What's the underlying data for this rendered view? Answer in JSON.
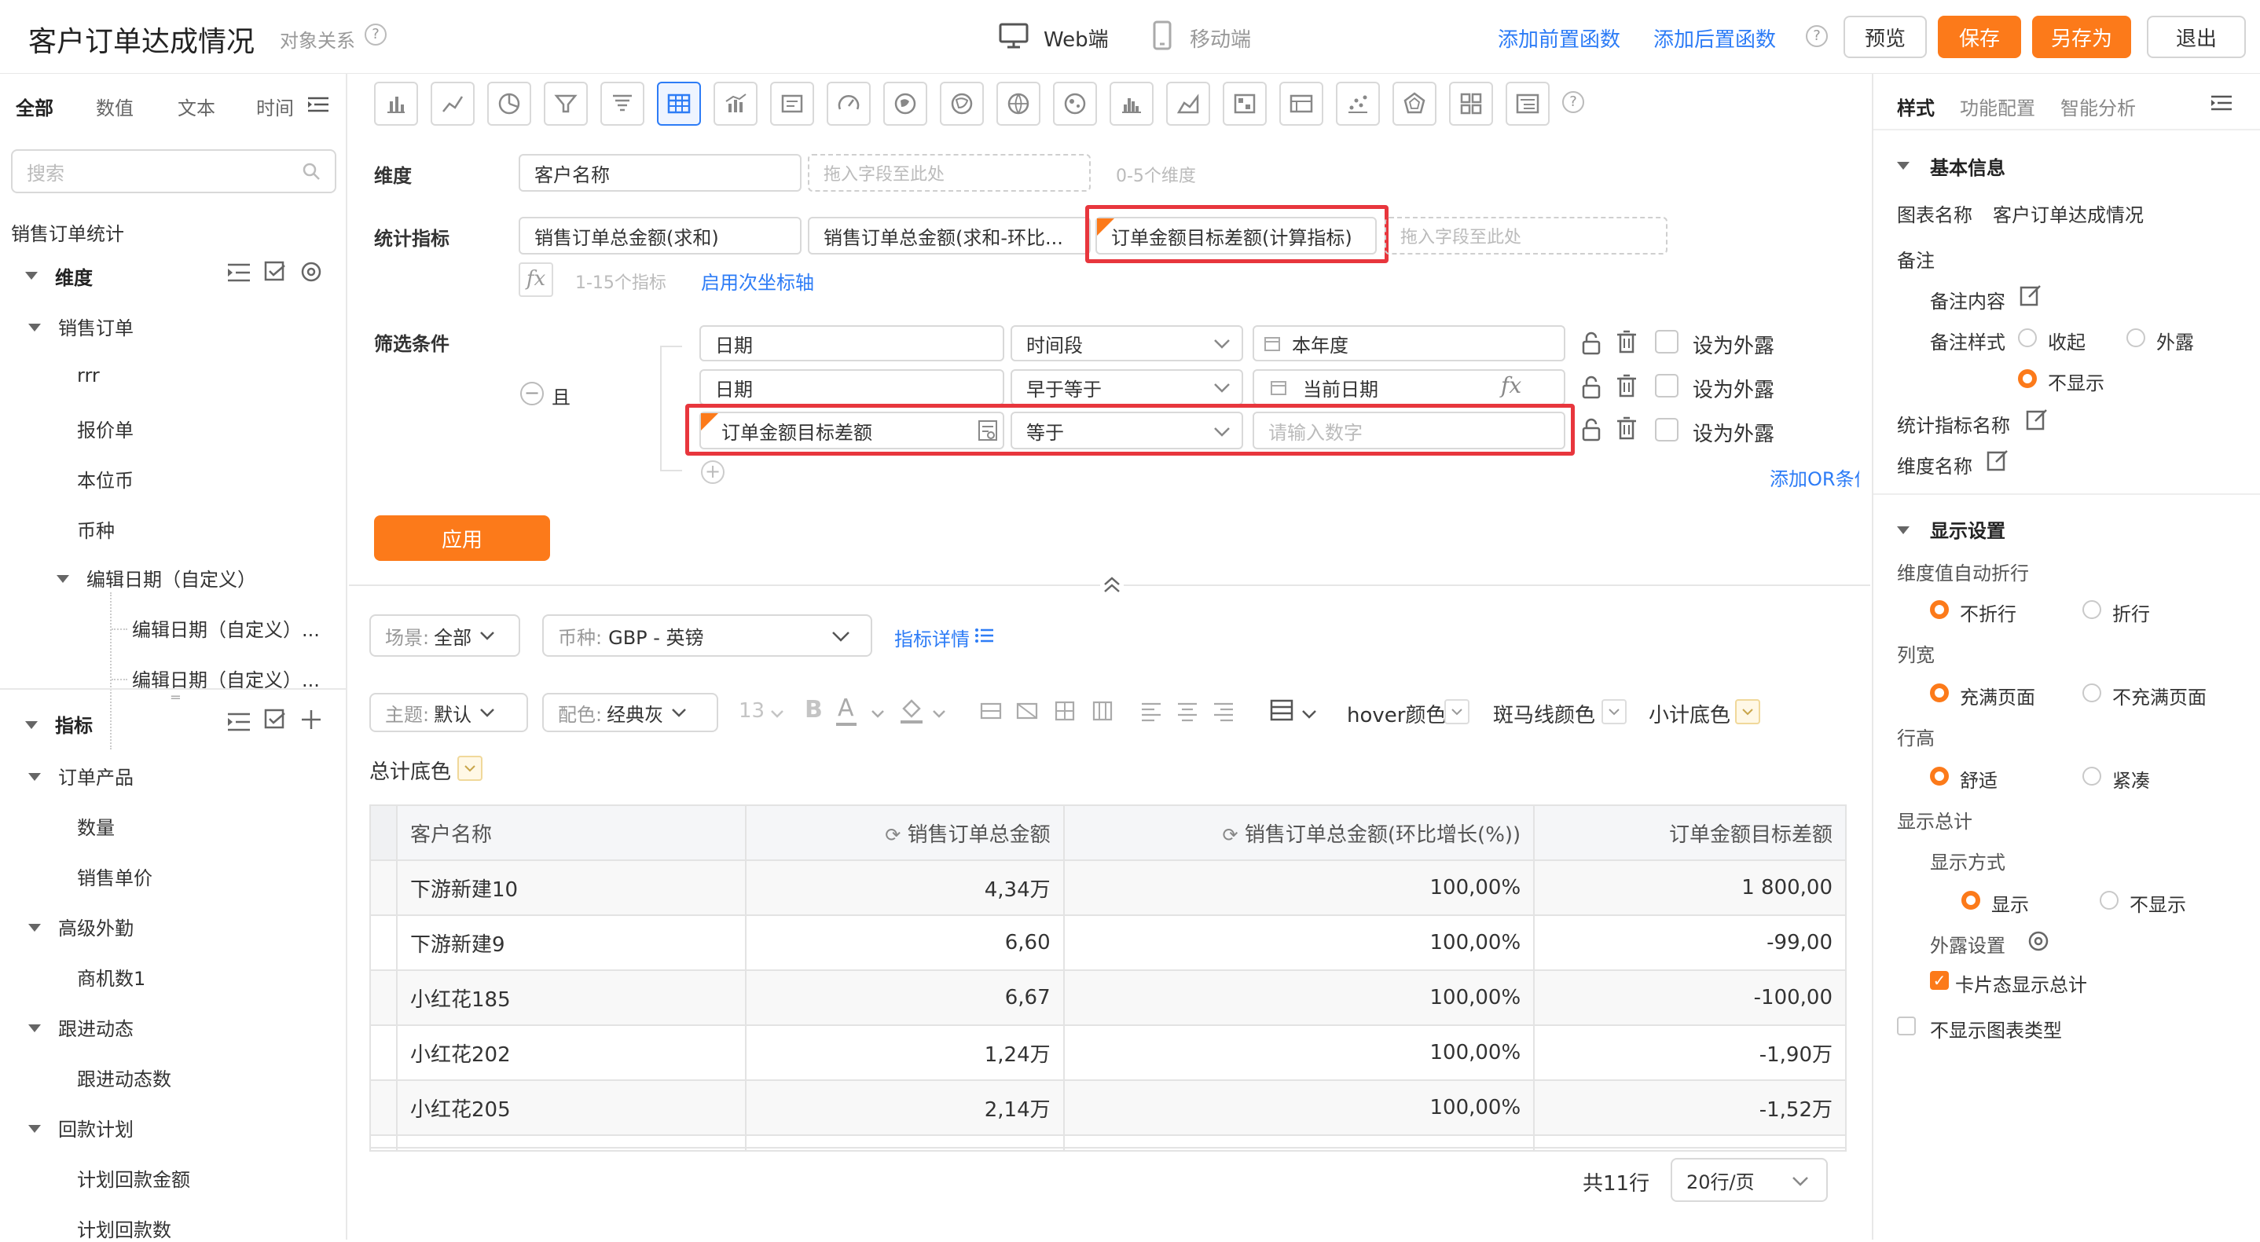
{
  "header": {
    "title": "客户订单达成情况",
    "subtitle": "对象关系",
    "mode_web": "Web端",
    "mode_mobile": "移动端",
    "add_pre_func": "添加前置函数",
    "add_post_func": "添加后置函数",
    "preview": "预览",
    "save": "保存",
    "save_as": "另存为",
    "exit": "退出"
  },
  "left": {
    "tabs": [
      "全部",
      "数值",
      "文本",
      "时间"
    ],
    "search_placeholder": "搜索",
    "object": "销售订单统计",
    "dim_group": "维度",
    "dim_tree": [
      {
        "label": "销售订单",
        "level": 1
      },
      {
        "label": "rrr",
        "level": 2
      },
      {
        "label": "报价单",
        "level": 2
      },
      {
        "label": "本位币",
        "level": 2
      },
      {
        "label": "币种",
        "level": 2
      },
      {
        "label": "编辑日期（自定义）",
        "level": 2
      },
      {
        "label": "编辑日期（自定义）...",
        "level": 3
      },
      {
        "label": "编辑日期（自定义）...",
        "level": 3
      }
    ],
    "metric_group": "指标",
    "metric_tree": [
      {
        "label": "订单产品",
        "level": 1
      },
      {
        "label": "数量",
        "level": 2
      },
      {
        "label": "销售单价",
        "level": 2
      },
      {
        "label": "高级外勤",
        "level": 1
      },
      {
        "label": "商机数1",
        "level": 2
      },
      {
        "label": "跟进动态",
        "level": 1
      },
      {
        "label": "跟进动态数",
        "level": 2
      },
      {
        "label": "回款计划",
        "level": 1
      },
      {
        "label": "计划回款金额",
        "level": 2
      },
      {
        "label": "计划回款数",
        "level": 2
      }
    ]
  },
  "config": {
    "dim_label": "维度",
    "dim_value": "客户名称",
    "drop_hint": "拖入字段至此处",
    "dim_range": "0-5个维度",
    "metric_label": "统计指标",
    "metrics": [
      "销售订单总金额(求和)",
      "销售订单总金额(求和-环比...",
      "订单金额目标差额(计算指标)"
    ],
    "metric_range": "1-15个指标",
    "secondary_axis": "启用次坐标轴",
    "filter_label": "筛选条件",
    "logic": "且",
    "filters": [
      {
        "field": "日期",
        "op": "时间段",
        "value": "本年度",
        "expose": "设为外露"
      },
      {
        "field": "日期",
        "op": "早于等于",
        "value": "当前日期",
        "expose": "设为外露"
      },
      {
        "field": "订单金额目标差额",
        "op": "等于",
        "value": "",
        "placeholder": "请输入数字",
        "expose": "设为外露"
      }
    ],
    "add_or": "添加OR条件",
    "apply": "应用"
  },
  "style_bar": {
    "scene_label": "场景:",
    "scene_value": "全部",
    "currency_label": "币种:",
    "currency_value": "GBP - 英镑",
    "metric_detail": "指标详情",
    "theme_label": "主题:",
    "theme_value": "默认",
    "palette_label": "配色:",
    "palette_value": "经典灰",
    "font_size": "13",
    "hover_color": "hover颜色",
    "zebra_color": "斑马线颜色",
    "subtotal_color": "小计底色",
    "total_color": "总计底色"
  },
  "table": {
    "columns": [
      "客户名称",
      "销售订单总金额",
      "销售订单总金额(环比增长(%))",
      "订单金额目标差额"
    ],
    "rows": [
      [
        "下游新建10",
        "4,34万",
        "100,00%",
        "1 800,00"
      ],
      [
        "下游新建9",
        "6,60",
        "100,00%",
        "-99,00"
      ],
      [
        "小红花185",
        "6,67",
        "100,00%",
        "-100,00"
      ],
      [
        "小红花202",
        "1,24万",
        "100,00%",
        "-1,90万"
      ],
      [
        "小红花205",
        "2,14万",
        "100,00%",
        "-1,52万"
      ]
    ],
    "total": "共11行",
    "page_size": "20行/页"
  },
  "right": {
    "tabs": [
      "样式",
      "功能配置",
      "智能分析"
    ],
    "basic_info": "基本信息",
    "chart_name_label": "图表名称",
    "chart_name_value": "客户订单达成情况",
    "remark": "备注",
    "remark_content": "备注内容",
    "remark_style": "备注样式",
    "collapse": "收起",
    "expose": "外露",
    "hide": "不显示",
    "metric_name": "统计指标名称",
    "dim_name": "维度名称",
    "display_settings": "显示设置",
    "auto_wrap": "维度值自动折行",
    "no_wrap": "不折行",
    "wrap": "折行",
    "col_width": "列宽",
    "fill_page": "充满页面",
    "no_fill_page": "不充满页面",
    "row_height": "行高",
    "comfortable": "舒适",
    "compact": "紧凑",
    "show_total": "显示总计",
    "display_mode": "显示方式",
    "show": "显示",
    "not_show": "不显示",
    "expose_setting": "外露设置",
    "card_total": "卡片态显示总计",
    "hide_chart_type": "不显示图表类型"
  },
  "colors": {
    "accent": "#fc7a1a",
    "link": "#2d7cf6",
    "highlight": "#e8363d"
  }
}
